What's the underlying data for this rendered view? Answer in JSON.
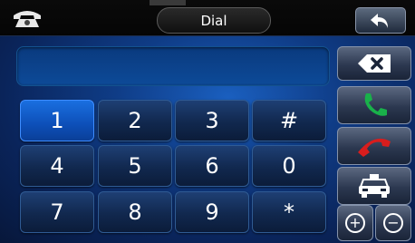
{
  "header": {
    "title": "Dial",
    "phone_icon": "telephone-icon",
    "back_icon": "undo-arrow-icon"
  },
  "display": {
    "value": ""
  },
  "keypad": [
    {
      "label": "1",
      "active": true
    },
    {
      "label": "2"
    },
    {
      "label": "3"
    },
    {
      "label": "#"
    },
    {
      "label": "4"
    },
    {
      "label": "5"
    },
    {
      "label": "6"
    },
    {
      "label": "0"
    },
    {
      "label": "7"
    },
    {
      "label": "8"
    },
    {
      "label": "9"
    },
    {
      "label": "*"
    }
  ],
  "side_controls": {
    "backspace_icon": "backspace-x-icon",
    "call_icon": "green-phone-icon",
    "hangup_icon": "red-phone-icon",
    "car_icon": "taxi-car-icon",
    "plus_label": "+",
    "minus_label": "−"
  },
  "colors": {
    "accent_blue": "#1a6fe0",
    "call_green": "#19b14a",
    "hangup_red": "#d81d1d"
  }
}
